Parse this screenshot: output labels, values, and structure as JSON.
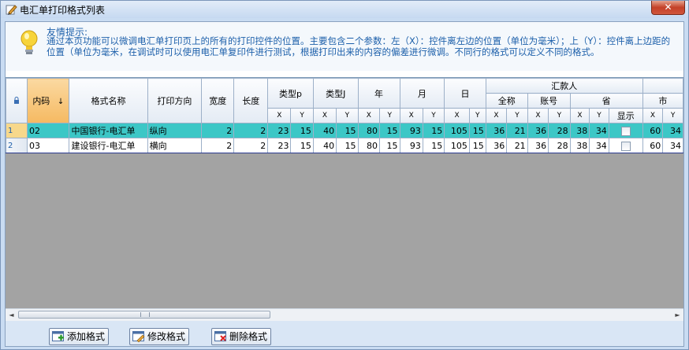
{
  "window": {
    "title": "电汇单打印格式列表",
    "close_label": "✕"
  },
  "tip": {
    "title": "友情提示:",
    "body": "通过本页功能可以微调电汇单打印页上的所有的打印控件的位置。主要包含二个参数：左（X）：控件离左边的位置（单位为毫米）；上（Y）：控件离上边距的位置（单位为毫米，在调试时可以使用电汇单复印件进行测试，根据打印出来的内容的偏差进行微调。不同行的格式可以定义不同的格式。"
  },
  "grid": {
    "corner_icon": "lock-icon",
    "headers": {
      "code": "内码",
      "sort_arrow": "↓",
      "name": "格式名称",
      "direction": "打印方向",
      "width": "宽度",
      "length": "长度",
      "type_p": "类型p",
      "type_j": "类型J",
      "year": "年",
      "month": "月",
      "day": "日",
      "remitter": "汇款人",
      "full_name": "全称",
      "account": "账号",
      "province": "省",
      "show": "显示",
      "city": "市",
      "x": "X",
      "y": "Y"
    },
    "rows": [
      {
        "num": "1",
        "code": "02",
        "name": "中国银行-电汇单",
        "direction": "纵向",
        "width": "2",
        "length": "2",
        "vals": [
          "23",
          "15",
          "40",
          "15",
          "80",
          "15",
          "93",
          "15",
          "105",
          "15",
          "36",
          "21",
          "36",
          "28",
          "38",
          "34"
        ],
        "city": [
          "60",
          "34"
        ]
      },
      {
        "num": "2",
        "code": "03",
        "name": "建设银行-电汇单",
        "direction": "横向",
        "width": "2",
        "length": "2",
        "vals": [
          "23",
          "15",
          "40",
          "15",
          "80",
          "15",
          "93",
          "15",
          "105",
          "15",
          "36",
          "21",
          "36",
          "28",
          "38",
          "34"
        ],
        "city": [
          "60",
          "34"
        ]
      }
    ]
  },
  "scroll": {
    "left_arrow": "◄",
    "right_arrow": "►"
  },
  "buttons": {
    "add": "添加格式",
    "edit": "修改格式",
    "delete": "删除格式"
  },
  "colors": {
    "selected_row": "#3cc7c6",
    "tip_text": "#1c5faa",
    "grid_empty": "#a3a3a3"
  }
}
